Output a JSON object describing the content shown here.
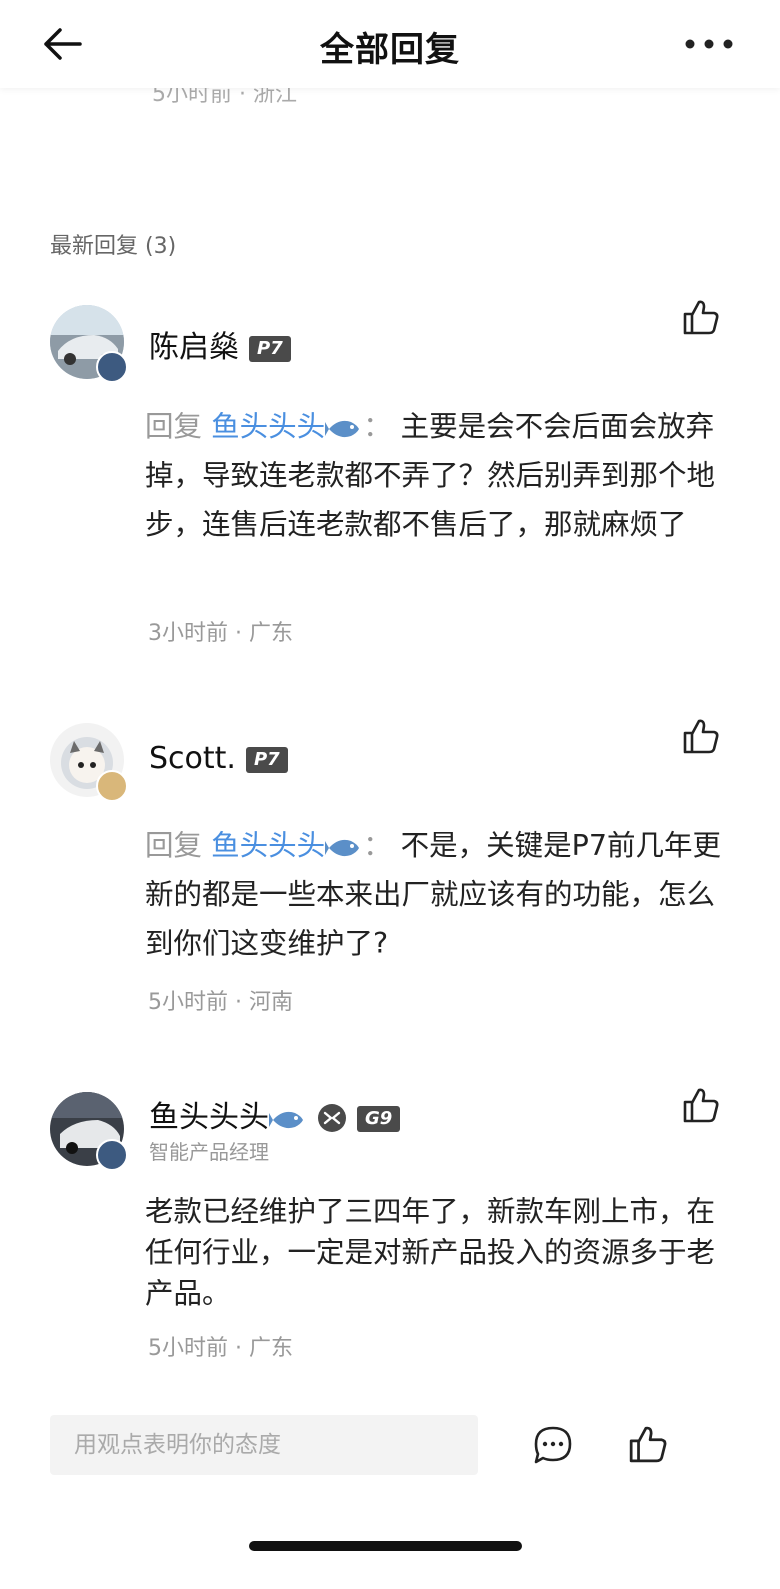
{
  "nav": {
    "title": "全部回复"
  },
  "previous_meta": "5小时前 · 浙江",
  "section": {
    "heading": "最新回复 (3)"
  },
  "comments": [
    {
      "user": "陈启燊",
      "tag": "P7",
      "reply_prefix": "回复",
      "mention": "鱼头头头",
      "colon": "：",
      "text": "主要是会不会后面会放弃掉，导致连老款都不弄了？然后别弄到那个地步，连售后连老款都不售后了，那就麻烦了",
      "meta": "3小时前 · 广东"
    },
    {
      "user": "Scott.",
      "tag": "P7",
      "reply_prefix": "回复",
      "mention": "鱼头头头",
      "colon": "：",
      "text": "不是，关键是P7前几年更新的都是一些本来出厂就应该有的功能，怎么到你们这变维护了?",
      "meta": "5小时前 · 河南"
    },
    {
      "user": "鱼头头头",
      "tag": "G9",
      "subtitle": "智能产品经理",
      "text": "老款已经维护了三四年了，新款车刚上市，在任何行业，一定是对新产品投入的资源多于老产品。",
      "meta": "5小时前 · 广东"
    }
  ],
  "bottom_bar": {
    "placeholder": "用观点表明你的态度"
  },
  "colors": {
    "mention": "#4a8fe0",
    "tag_bg": "#4a4a4a",
    "meta": "#999999"
  }
}
